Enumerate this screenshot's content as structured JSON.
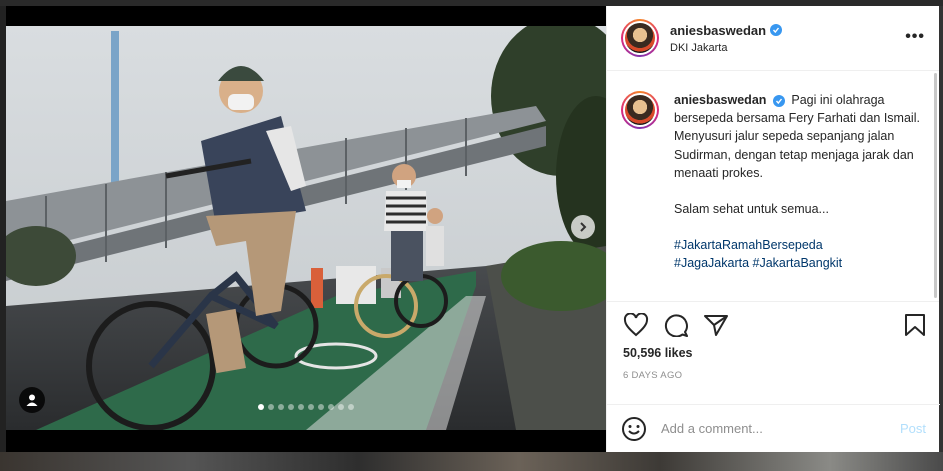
{
  "post": {
    "username": "aniesbaswedan",
    "location": "DKI Jakarta",
    "caption": {
      "username": "aniesbaswedan",
      "text": "Pagi ini olahraga bersepeda bersama Fery Farhati dan Ismail. Menyusuri jalur sepeda sepanjang jalan Sudirman, dengan tetap menjaga jarak dan menaati prokes.",
      "greeting": "Salam sehat untuk semua...",
      "hashtags_line1": "#JakartaRamahBersepeda",
      "hashtags_line2": "#JagaJakarta #JakartaBangkit"
    },
    "likes": "50,596 likes",
    "posted": "6 DAYS AGO"
  },
  "carousel": {
    "total": 10,
    "active": 1
  },
  "comment": {
    "placeholder": "Add a comment...",
    "post_label": "Post"
  },
  "colors": {
    "link": "#00376b",
    "verified": "#3897f0",
    "post_disabled": "#b2dffc",
    "muted": "#8e8e8e"
  },
  "icons": {
    "more": "more-options-icon",
    "like": "heart-icon",
    "comment": "comment-bubble-icon",
    "share": "paper-plane-icon",
    "save": "bookmark-icon",
    "emoji": "smiley-icon",
    "next": "chevron-right-icon",
    "tags": "person-tag-icon"
  }
}
